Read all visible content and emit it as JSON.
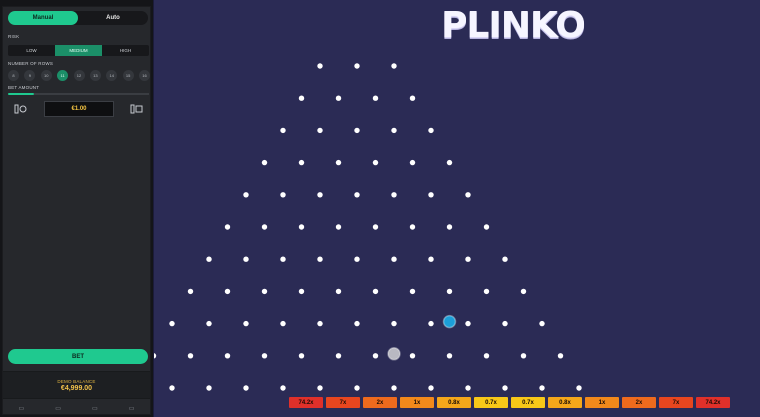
{
  "panel": {
    "modes": [
      {
        "label": "Manual",
        "active": true
      },
      {
        "label": "Auto",
        "active": false
      }
    ],
    "risk_label": "RISK",
    "risk_options": [
      {
        "label": "LOW",
        "active": false
      },
      {
        "label": "MEDIUM",
        "active": true
      },
      {
        "label": "HIGH",
        "active": false
      }
    ],
    "rows_label": "NUMBER OF ROWS",
    "row_options": [
      {
        "label": "8",
        "active": false
      },
      {
        "label": "9",
        "active": false
      },
      {
        "label": "10",
        "active": false
      },
      {
        "label": "11",
        "active": true
      },
      {
        "label": "12",
        "active": false
      },
      {
        "label": "13",
        "active": false
      },
      {
        "label": "14",
        "active": false
      },
      {
        "label": "15",
        "active": false
      },
      {
        "label": "16",
        "active": false
      }
    ],
    "bet_amount_label": "BET AMOUNT",
    "bet_amount_value": "€1.00",
    "bet_button_label": "BET",
    "balance_label": "DEMO BALANCE",
    "balance_value": "€4,999.00",
    "nav": [
      {
        "icon": "▭",
        "name": "nav-item-1"
      },
      {
        "icon": "▭",
        "name": "nav-item-2"
      },
      {
        "icon": "▭",
        "name": "nav-item-3"
      },
      {
        "icon": "▭",
        "name": "nav-item-4"
      }
    ]
  },
  "board": {
    "title": "PLINKO",
    "multipliers": [
      {
        "label": "74.2x",
        "color": "#e0302a"
      },
      {
        "label": "7x",
        "color": "#e8461f"
      },
      {
        "label": "2x",
        "color": "#ee6a1d"
      },
      {
        "label": "1x",
        "color": "#f2891b"
      },
      {
        "label": "0.8x",
        "color": "#f5a71a"
      },
      {
        "label": "0.7x",
        "color": "#f8c818"
      },
      {
        "label": "0.7x",
        "color": "#f8c818"
      },
      {
        "label": "0.8x",
        "color": "#f5a71a"
      },
      {
        "label": "1x",
        "color": "#f2891b"
      },
      {
        "label": "2x",
        "color": "#ee6a1d"
      },
      {
        "label": "7x",
        "color": "#e8461f"
      },
      {
        "label": "74.2x",
        "color": "#e0302a"
      }
    ],
    "peg_rows": 11,
    "pegs_first_row": 3,
    "balls": [
      {
        "color": "#1c9fd8",
        "row": 8,
        "between": 8
      },
      {
        "color": "#b9b9c2",
        "row": 9,
        "between": 7
      }
    ]
  },
  "colors": {
    "accent": "#1fc98f",
    "board_bg": "#2b2b55",
    "panel_bg": "#26282c",
    "balance": "#f1c24b"
  }
}
